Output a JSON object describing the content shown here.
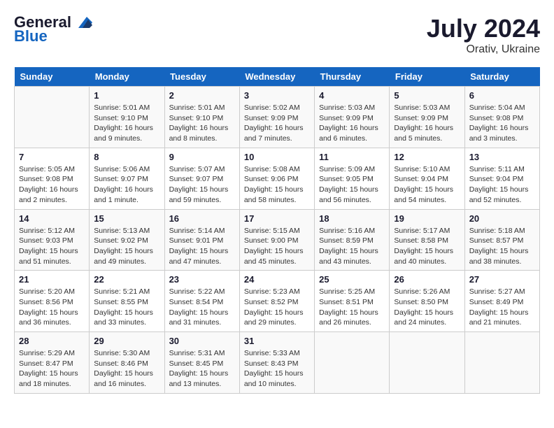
{
  "header": {
    "logo_line1": "General",
    "logo_line2": "Blue",
    "title": "July 2024",
    "subtitle": "Orativ, Ukraine"
  },
  "days_header": [
    "Sunday",
    "Monday",
    "Tuesday",
    "Wednesday",
    "Thursday",
    "Friday",
    "Saturday"
  ],
  "weeks": [
    [
      {
        "day": "",
        "info": ""
      },
      {
        "day": "1",
        "info": "Sunrise: 5:01 AM\nSunset: 9:10 PM\nDaylight: 16 hours\nand 9 minutes."
      },
      {
        "day": "2",
        "info": "Sunrise: 5:01 AM\nSunset: 9:10 PM\nDaylight: 16 hours\nand 8 minutes."
      },
      {
        "day": "3",
        "info": "Sunrise: 5:02 AM\nSunset: 9:09 PM\nDaylight: 16 hours\nand 7 minutes."
      },
      {
        "day": "4",
        "info": "Sunrise: 5:03 AM\nSunset: 9:09 PM\nDaylight: 16 hours\nand 6 minutes."
      },
      {
        "day": "5",
        "info": "Sunrise: 5:03 AM\nSunset: 9:09 PM\nDaylight: 16 hours\nand 5 minutes."
      },
      {
        "day": "6",
        "info": "Sunrise: 5:04 AM\nSunset: 9:08 PM\nDaylight: 16 hours\nand 3 minutes."
      }
    ],
    [
      {
        "day": "7",
        "info": "Sunrise: 5:05 AM\nSunset: 9:08 PM\nDaylight: 16 hours\nand 2 minutes."
      },
      {
        "day": "8",
        "info": "Sunrise: 5:06 AM\nSunset: 9:07 PM\nDaylight: 16 hours\nand 1 minute."
      },
      {
        "day": "9",
        "info": "Sunrise: 5:07 AM\nSunset: 9:07 PM\nDaylight: 15 hours\nand 59 minutes."
      },
      {
        "day": "10",
        "info": "Sunrise: 5:08 AM\nSunset: 9:06 PM\nDaylight: 15 hours\nand 58 minutes."
      },
      {
        "day": "11",
        "info": "Sunrise: 5:09 AM\nSunset: 9:05 PM\nDaylight: 15 hours\nand 56 minutes."
      },
      {
        "day": "12",
        "info": "Sunrise: 5:10 AM\nSunset: 9:04 PM\nDaylight: 15 hours\nand 54 minutes."
      },
      {
        "day": "13",
        "info": "Sunrise: 5:11 AM\nSunset: 9:04 PM\nDaylight: 15 hours\nand 52 minutes."
      }
    ],
    [
      {
        "day": "14",
        "info": "Sunrise: 5:12 AM\nSunset: 9:03 PM\nDaylight: 15 hours\nand 51 minutes."
      },
      {
        "day": "15",
        "info": "Sunrise: 5:13 AM\nSunset: 9:02 PM\nDaylight: 15 hours\nand 49 minutes."
      },
      {
        "day": "16",
        "info": "Sunrise: 5:14 AM\nSunset: 9:01 PM\nDaylight: 15 hours\nand 47 minutes."
      },
      {
        "day": "17",
        "info": "Sunrise: 5:15 AM\nSunset: 9:00 PM\nDaylight: 15 hours\nand 45 minutes."
      },
      {
        "day": "18",
        "info": "Sunrise: 5:16 AM\nSunset: 8:59 PM\nDaylight: 15 hours\nand 43 minutes."
      },
      {
        "day": "19",
        "info": "Sunrise: 5:17 AM\nSunset: 8:58 PM\nDaylight: 15 hours\nand 40 minutes."
      },
      {
        "day": "20",
        "info": "Sunrise: 5:18 AM\nSunset: 8:57 PM\nDaylight: 15 hours\nand 38 minutes."
      }
    ],
    [
      {
        "day": "21",
        "info": "Sunrise: 5:20 AM\nSunset: 8:56 PM\nDaylight: 15 hours\nand 36 minutes."
      },
      {
        "day": "22",
        "info": "Sunrise: 5:21 AM\nSunset: 8:55 PM\nDaylight: 15 hours\nand 33 minutes."
      },
      {
        "day": "23",
        "info": "Sunrise: 5:22 AM\nSunset: 8:54 PM\nDaylight: 15 hours\nand 31 minutes."
      },
      {
        "day": "24",
        "info": "Sunrise: 5:23 AM\nSunset: 8:52 PM\nDaylight: 15 hours\nand 29 minutes."
      },
      {
        "day": "25",
        "info": "Sunrise: 5:25 AM\nSunset: 8:51 PM\nDaylight: 15 hours\nand 26 minutes."
      },
      {
        "day": "26",
        "info": "Sunrise: 5:26 AM\nSunset: 8:50 PM\nDaylight: 15 hours\nand 24 minutes."
      },
      {
        "day": "27",
        "info": "Sunrise: 5:27 AM\nSunset: 8:49 PM\nDaylight: 15 hours\nand 21 minutes."
      }
    ],
    [
      {
        "day": "28",
        "info": "Sunrise: 5:29 AM\nSunset: 8:47 PM\nDaylight: 15 hours\nand 18 minutes."
      },
      {
        "day": "29",
        "info": "Sunrise: 5:30 AM\nSunset: 8:46 PM\nDaylight: 15 hours\nand 16 minutes."
      },
      {
        "day": "30",
        "info": "Sunrise: 5:31 AM\nSunset: 8:45 PM\nDaylight: 15 hours\nand 13 minutes."
      },
      {
        "day": "31",
        "info": "Sunrise: 5:33 AM\nSunset: 8:43 PM\nDaylight: 15 hours\nand 10 minutes."
      },
      {
        "day": "",
        "info": ""
      },
      {
        "day": "",
        "info": ""
      },
      {
        "day": "",
        "info": ""
      }
    ]
  ]
}
